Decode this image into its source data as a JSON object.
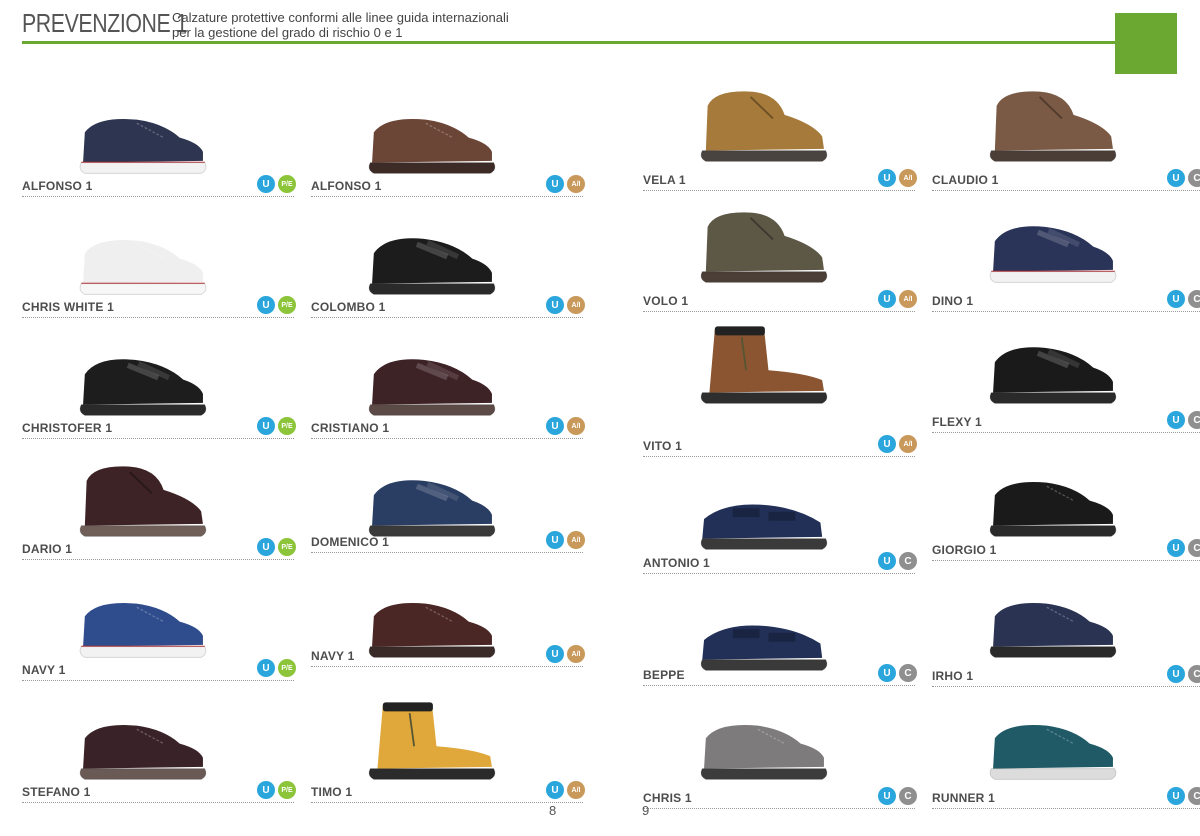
{
  "header": {
    "title": "PREVENZIONE 1",
    "subtitle_line1": "Calzature protettive conformi alle linee guida internazionali",
    "subtitle_line2": "per la gestione del grado di rischio 0 e 1"
  },
  "colors": {
    "accent": "#6aa832",
    "badge_u": "#2aa6dc",
    "badge_pe": "#8cc43a",
    "badge_ai": "#c8995a",
    "badge_c": "#8f8f8f"
  },
  "products": [
    {
      "name": "ALFONSO 1",
      "badge2": "P/E",
      "upper": "#2e3550",
      "sole": "#f2f2f2",
      "stripe": "#c0282d",
      "style": "low"
    },
    {
      "name": "CHRIS WHITE 1",
      "badge2": "P/E",
      "upper": "#efefef",
      "sole": "#f7f7f7",
      "stripe": "#c0282d",
      "style": "low"
    },
    {
      "name": "CHRISTOFER 1",
      "badge2": "P/E",
      "upper": "#1d1d1d",
      "sole": "#2a2a2a",
      "stripe": "",
      "style": "velcro"
    },
    {
      "name": "DARIO 1",
      "badge2": "P/E",
      "upper": "#3e2326",
      "sole": "#6f5f58",
      "stripe": "",
      "style": "high"
    },
    {
      "name": "NAVY 1",
      "badge2": "P/E",
      "upper": "#2f4c8c",
      "sole": "#f2f2f2",
      "stripe": "#c0282d",
      "style": "low"
    },
    {
      "name": "STEFANO 1",
      "badge2": "P/E",
      "upper": "#3a2328",
      "sole": "#6a5a55",
      "stripe": "",
      "style": "low"
    },
    {
      "name": "ALFONSO 1",
      "badge2": "A/I",
      "upper": "#6b4536",
      "sole": "#3d2b27",
      "stripe": "",
      "style": "low"
    },
    {
      "name": "COLOMBO 1",
      "badge2": "A/I",
      "upper": "#1c1c1c",
      "sole": "#2a2a2a",
      "stripe": "",
      "style": "velcro"
    },
    {
      "name": "CRISTIANO 1",
      "badge2": "A/I",
      "upper": "#3d2226",
      "sole": "#5b4a46",
      "stripe": "",
      "style": "velcro"
    },
    {
      "name": "DOMENICO 1",
      "badge2": "A/I",
      "upper": "#2a3d62",
      "sole": "#3a3a3a",
      "stripe": "",
      "style": "velcro"
    },
    {
      "name": "NAVY 1",
      "badge2": "A/I",
      "upper": "#4a2624",
      "sole": "#3a2a28",
      "stripe": "",
      "style": "low"
    },
    {
      "name": "TIMO 1",
      "badge2": "A/I",
      "upper": "#e0a83a",
      "sole": "#2b2b2b",
      "stripe": "",
      "style": "boot"
    },
    {
      "name": "VELA 1",
      "badge2": "A/I",
      "upper": "#a67a3a",
      "sole": "#4a4440",
      "stripe": "",
      "style": "high"
    },
    {
      "name": "VOLO 1",
      "badge2": "A/I",
      "upper": "#5d5746",
      "sole": "#4a3e36",
      "stripe": "",
      "style": "high"
    },
    {
      "name": "VITO 1",
      "badge2": "A/I",
      "upper": "#8a5530",
      "sole": "#2e2e2e",
      "stripe": "",
      "style": "boot"
    },
    {
      "name": "ANTONIO 1",
      "badge2": "C",
      "upper": "#223058",
      "sole": "#3a3a3a",
      "stripe": "",
      "style": "sandal"
    },
    {
      "name": "BEPPE",
      "badge2": "C",
      "upper": "#223058",
      "sole": "#3a3a3a",
      "stripe": "",
      "style": "sandal"
    },
    {
      "name": "CHRIS 1",
      "badge2": "C",
      "upper": "#7d7b7b",
      "sole": "#3c3c3c",
      "stripe": "",
      "style": "low"
    },
    {
      "name": "CLAUDIO 1",
      "badge2": "C",
      "upper": "#7a5a44",
      "sole": "#4a3e36",
      "stripe": "",
      "style": "high"
    },
    {
      "name": "DINO 1",
      "badge2": "C",
      "upper": "#2a3458",
      "sole": "#f2f2f2",
      "stripe": "#c0282d",
      "style": "velcro"
    },
    {
      "name": "FLEXY 1",
      "badge2": "C",
      "upper": "#1a1a1a",
      "sole": "#2a2a2a",
      "stripe": "",
      "style": "velcro"
    },
    {
      "name": "GIORGIO 1",
      "badge2": "C",
      "upper": "#1a1a1a",
      "sole": "#2a2a2a",
      "stripe": "",
      "style": "low"
    },
    {
      "name": "IRHO 1",
      "badge2": "C",
      "upper": "#2a3352",
      "sole": "#2a2a2a",
      "stripe": "",
      "style": "low"
    },
    {
      "name": "RUNNER 1",
      "badge2": "C",
      "upper": "#1f5a66",
      "sole": "#dcdcdc",
      "stripe": "",
      "style": "low"
    }
  ],
  "badge_labels": {
    "u": "U"
  },
  "page_left": "8",
  "page_right": "9"
}
